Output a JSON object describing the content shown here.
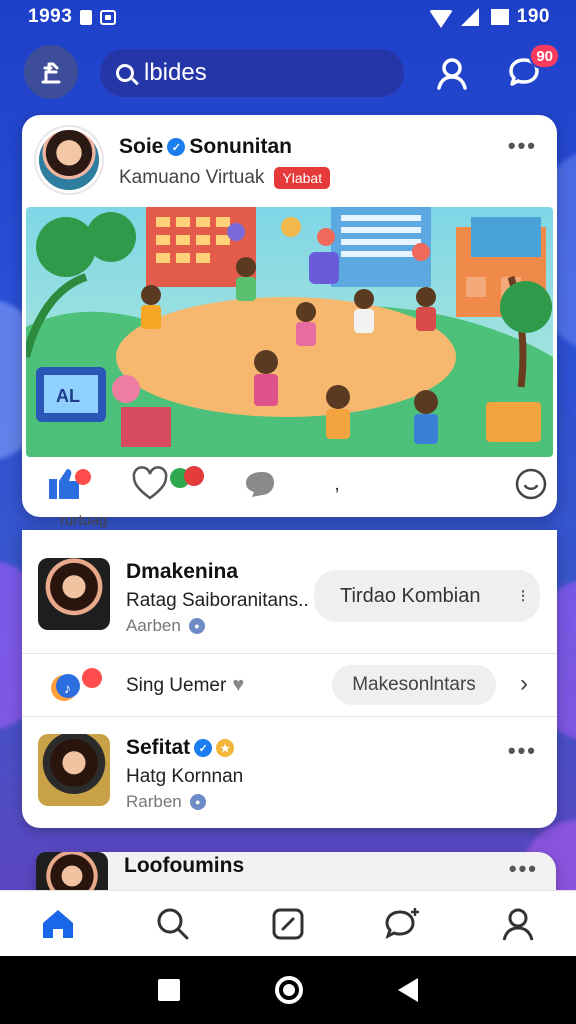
{
  "status_bar": {
    "time": "1993",
    "battery": "190"
  },
  "top_bar": {
    "search_placeholder": "lbides",
    "notification_count": "90"
  },
  "post": {
    "author": "Soie",
    "author_rest": "Sonunitan",
    "subtitle": "Kamuano Virtuak",
    "tag": "Ylabat",
    "more": "•••",
    "caption": "rurtuag",
    "illustration_panel_text": "AL"
  },
  "list": {
    "items": [
      {
        "title": "Dmakenina",
        "subtitle": "Ratag Saiboranitans..",
        "meta": "Aarben",
        "action": "Tirdao Kombian",
        "action_more": "⁝"
      },
      {
        "title": "Sing Uemer",
        "action": "Makesonlntars"
      },
      {
        "title": "Sefitat",
        "subtitle": "Hatg Kornnan",
        "meta": "Rarben",
        "more": "•••"
      }
    ],
    "peek": {
      "title": "Loofoumins",
      "more": "•••"
    }
  },
  "colors": {
    "primary": "#1e40c8",
    "accent": "#1a7df0",
    "badge": "#ff3b5c",
    "tag": "#e63a3a"
  }
}
